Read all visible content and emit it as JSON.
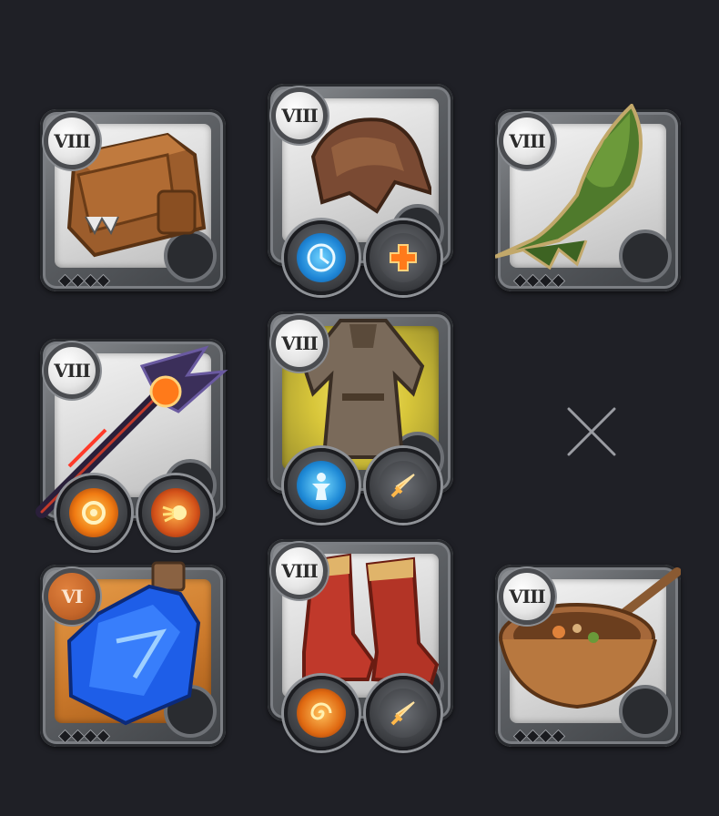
{
  "grid": {
    "slots": [
      {
        "id": "bag",
        "tier": "VIII",
        "tier_color": "silver",
        "item": "bag",
        "spells": []
      },
      {
        "id": "head",
        "tier": "VIII",
        "tier_color": "silver",
        "item": "cowl",
        "spells": [
          "clock-spell-icon",
          "heal-plus-spell-icon"
        ]
      },
      {
        "id": "cape",
        "tier": "VIII",
        "tier_color": "silver",
        "item": "cape",
        "spells": []
      },
      {
        "id": "weapon",
        "tier": "VIII",
        "tier_color": "silver",
        "item": "fire-staff",
        "spells": [
          "fire-ring-spell-icon",
          "fireball-spell-icon"
        ]
      },
      {
        "id": "armor",
        "tier": "VIII",
        "tier_color": "silver",
        "item": "robe",
        "spells": [
          "blue-figure-spell-icon",
          "sword-spell-icon"
        ]
      },
      {
        "id": "offhand",
        "empty": true
      },
      {
        "id": "potion",
        "tier": "VI",
        "tier_color": "orange",
        "item": "potion",
        "spells": []
      },
      {
        "id": "shoes",
        "tier": "VIII",
        "tier_color": "silver",
        "item": "boots",
        "spells": [
          "swirl-spell-icon",
          "sword-spell-icon"
        ]
      },
      {
        "id": "food",
        "tier": "VIII",
        "tier_color": "silver",
        "item": "stew",
        "spells": []
      }
    ]
  },
  "colors": {
    "background": "#1f2026",
    "close_x": "#9a9ca2",
    "tier_orange": "#c4662a"
  }
}
